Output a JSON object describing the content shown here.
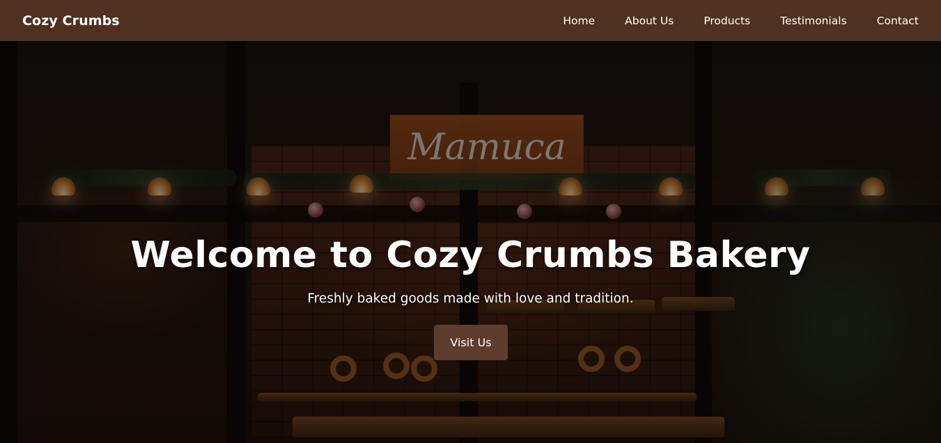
{
  "navbar": {
    "brand": "Cozy Crumbs",
    "links": [
      "Home",
      "About Us",
      "Products",
      "Testimonials",
      "Contact"
    ]
  },
  "hero": {
    "title": "Welcome to Cozy Crumbs Bakery",
    "subtitle": "Freshly baked goods made with love and tradition.",
    "cta_label": "Visit Us",
    "sign_text": "Mamuca"
  },
  "colors": {
    "navbar_bg": "#4e3120",
    "button_bg": "#5d3b2d",
    "text": "#ffffff"
  }
}
